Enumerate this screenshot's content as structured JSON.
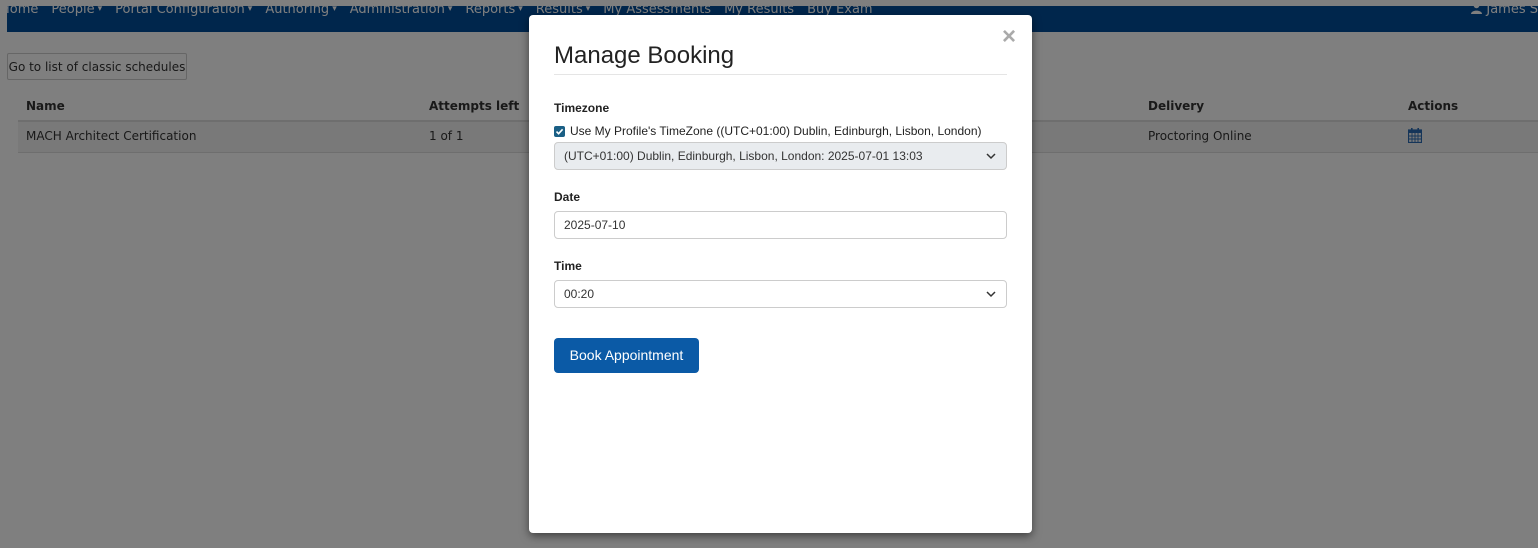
{
  "navbar": {
    "items": [
      {
        "label": "Home",
        "dropdown": false
      },
      {
        "label": "People",
        "dropdown": true
      },
      {
        "label": "Portal Configuration",
        "dropdown": true
      },
      {
        "label": "Authoring",
        "dropdown": true
      },
      {
        "label": "Administration",
        "dropdown": true
      },
      {
        "label": "Reports",
        "dropdown": true
      },
      {
        "label": "Results",
        "dropdown": true
      },
      {
        "label": "My Assessments",
        "dropdown": false
      },
      {
        "label": "My Results",
        "dropdown": false
      },
      {
        "label": "Buy Exam",
        "dropdown": false
      }
    ],
    "user": "James S",
    "caret": "▾"
  },
  "page": {
    "classic_button": "Go to list of classic schedules",
    "table": {
      "headers": {
        "name": "Name",
        "attempts": "Attempts left",
        "delivery": "Delivery",
        "actions": "Actions"
      },
      "rows": [
        {
          "name": "MACH Architect Certification",
          "attempts": "1 of 1",
          "delivery": "Proctoring Online",
          "action_icon": "calendar-icon"
        }
      ]
    }
  },
  "modal": {
    "title": "Manage Booking",
    "close": "×",
    "timezone_label": "Timezone",
    "use_profile_checked": true,
    "use_profile_label": "Use My Profile's TimeZone ((UTC+01:00) Dublin, Edinburgh, Lisbon, London)",
    "timezone_value": "(UTC+01:00) Dublin, Edinburgh, Lisbon, London: 2025-07-01 13:03",
    "date_label": "Date",
    "date_value": "2025-07-10",
    "time_label": "Time",
    "time_value": "00:20",
    "book_button": "Book Appointment"
  },
  "colors": {
    "navbar": "#004d99",
    "primary_button": "#0b5aa6",
    "checkbox": "#1a5f85",
    "icon": "#2a6ab3"
  }
}
